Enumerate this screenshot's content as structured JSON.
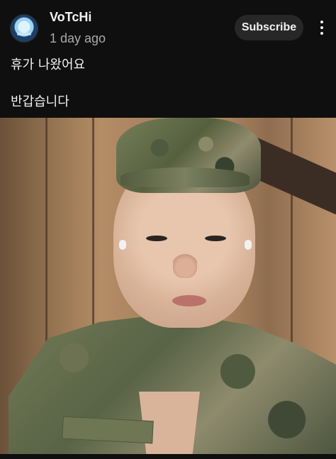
{
  "post": {
    "channel_name": "VoTcHi",
    "time": "1 day ago",
    "subscribe_label": "Subscribe",
    "more_icon": "more-vert-icon",
    "avatar_icon": "channel-avatar-icon",
    "text_line_1": "휴가 나왔어요",
    "text_line_2": "반갑습니다"
  },
  "colors": {
    "background": "#0f0f0f",
    "text_primary": "#f1f1f1",
    "text_secondary": "#aaaaaa",
    "button_background": "#272727"
  }
}
